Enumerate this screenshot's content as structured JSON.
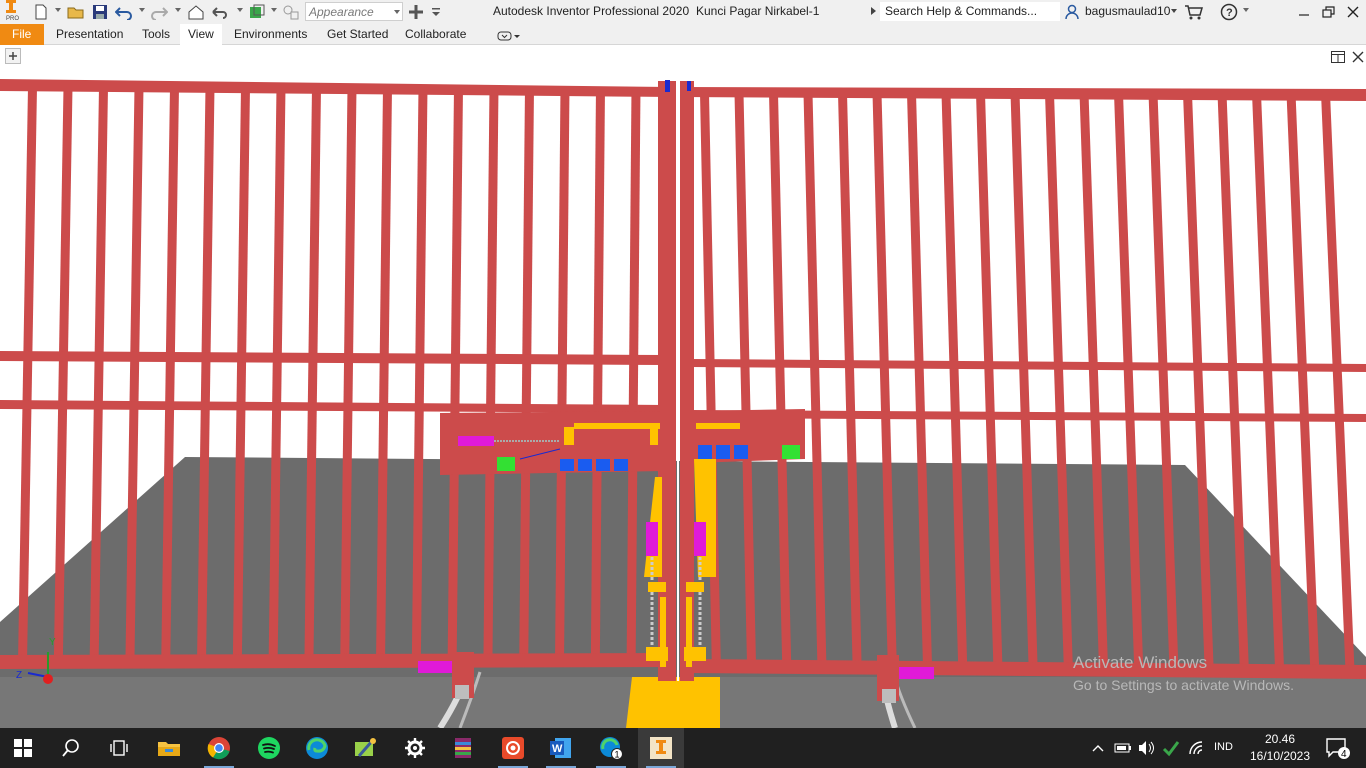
{
  "titlebar": {
    "app_title": "Autodesk Inventor Professional 2020",
    "document_title": "Kunci Pagar Nirkabel-1",
    "appearance_value": "Appearance",
    "search_placeholder": "Search Help & Commands...",
    "user_name": "bagusmaulad10",
    "app_logo_letters": "I PRO"
  },
  "ribbon": {
    "tabs": [
      {
        "label": "File",
        "active": false
      },
      {
        "label": "Presentation",
        "active": false
      },
      {
        "label": "Tools",
        "active": false
      },
      {
        "label": "View",
        "active": true
      },
      {
        "label": "Environments",
        "active": false
      },
      {
        "label": "Get Started",
        "active": false
      },
      {
        "label": "Collaborate",
        "active": false
      }
    ]
  },
  "viewport": {
    "watermark_title": "Activate Windows",
    "watermark_subtitle": "Go to Settings to activate Windows.",
    "view_cube_axes": [
      "Y",
      "Z"
    ]
  },
  "taskbar": {
    "time": "20.46",
    "date": "16/10/2023",
    "language": "IND",
    "notification_count": "4",
    "chrome_badge": "",
    "edge_badge": "1"
  },
  "colors": {
    "file_tab": "#f08a12",
    "fence": "#cc4b4b",
    "floor": "#6c6c6c",
    "yellow_part": "#ffc200",
    "magenta_part": "#e01ad8",
    "blue_part": "#1a5cf0",
    "green_part": "#33e033",
    "taskbar": "#202020"
  }
}
